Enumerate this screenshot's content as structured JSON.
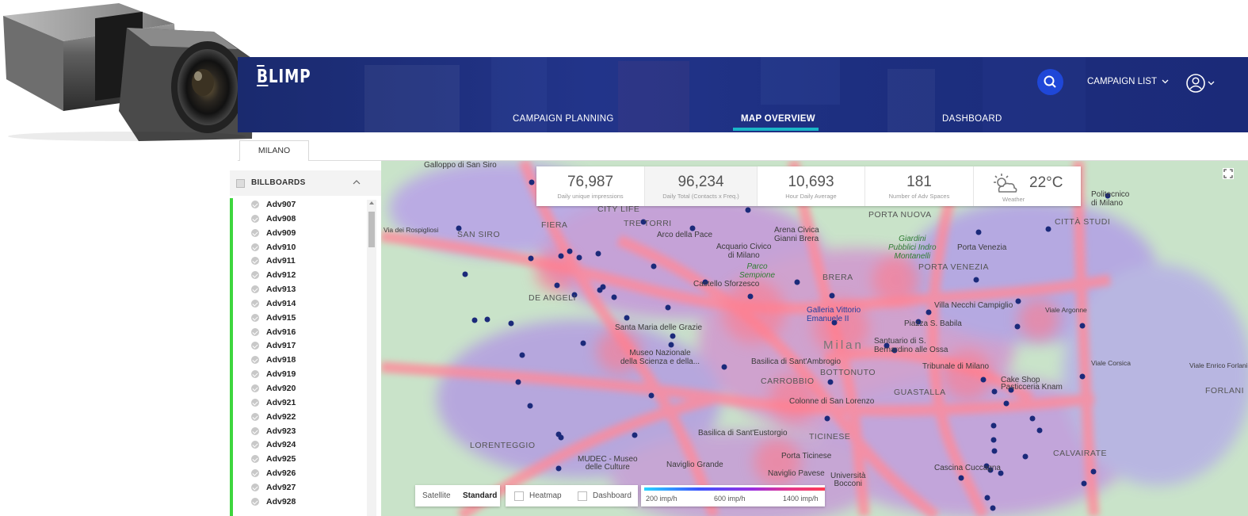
{
  "app": {
    "logo": "BLIMP"
  },
  "nav": {
    "items": [
      "CAMPAIGN PLANNING",
      "MAP OVERVIEW",
      "DASHBOARD"
    ],
    "active": "MAP OVERVIEW",
    "campaign_list": "CAMPAIGN LIST",
    "accent": "#19b5c7"
  },
  "city_tab": "MILANO",
  "sidebar": {
    "header": "BILLBOARDS",
    "items": [
      "Adv907",
      "Adv908",
      "Adv909",
      "Adv910",
      "Adv911",
      "Adv912",
      "Adv913",
      "Adv914",
      "Adv915",
      "Adv916",
      "Adv917",
      "Adv918",
      "Adv919",
      "Adv920",
      "Adv921",
      "Adv922",
      "Adv923",
      "Adv924",
      "Adv925",
      "Adv926",
      "Adv927",
      "Adv928"
    ],
    "active_color": "#3dd63d"
  },
  "stats": [
    {
      "value": "76,987",
      "label": "Daily unique impressions"
    },
    {
      "value": "96,234",
      "label": "Daily Total (Contacts x Freq.)"
    },
    {
      "value": "10,693",
      "label": "Hour Daily Average"
    },
    {
      "value": "181",
      "label": "Number of Adv Spaces"
    }
  ],
  "weather": {
    "temp": "22°C",
    "label": "Weather",
    "icon": "partly-cloudy-icon"
  },
  "map_controls": {
    "satellite": "Satellite",
    "standard": "Standard",
    "heatmap": "Heatmap",
    "dashboard": "Dashboard",
    "legend": [
      "200 imp/h",
      "600 imp/h",
      "1400 imp/h"
    ]
  },
  "map_labels": {
    "galloppo": "Galloppo di San Siro",
    "via_rospigliosi": "Via dei Rospigliosi",
    "san_siro": "SAN SIRO",
    "fiera": "FIERA",
    "city_life": "CITY LIFE",
    "tre_torri": "TRE TORRI",
    "arco": "Arco della Pace",
    "acquario": "Acquario Civico\ndi Milano",
    "parco": "Parco\nSempione",
    "arena": "Arena Civica\nGianni Brera",
    "giardini": "Giardini\nPubblici Indro\nMontanelli",
    "porta_venezia_pin": "Porta Venezia",
    "porta_venezia": "PORTA VENEZIA",
    "porta_nuova": "PORTA NUOVA",
    "citta_studi": "CITTÀ STUDI",
    "politecnico": "Politecnico\ndi Milano",
    "de_angeli": "DE ANGELI",
    "castello": "Castello Sforzesco",
    "brera": "BRERA",
    "villa_necchi": "Villa Necchi Campiglio",
    "galleria": "Galleria Vittorio\nEmanuele II",
    "babila": "Piazza S. Babila",
    "santa_maria": "Santa Maria delle Grazie",
    "museo": "Museo Nazionale\ndella Scienza e della...",
    "milan": "Milan",
    "santuario": "Santuario di S.\nBernardino alle Ossa",
    "viale_argonne": "Viale Argonne",
    "basilica_ambrogio": "Basilica di Sant'Ambrogio",
    "bottonuto": "BOTTONUTO",
    "tribunale": "Tribunale di Milano",
    "viale_corsica": "Viale Corsica",
    "viale_forlanini": "Viale Enrico Forlanini",
    "carrobbio": "CARROBBIO",
    "cake_shop": "Cake Shop\nPasticceria Knam",
    "guastalla": "GUASTALLA",
    "forlanini": "FORLANI",
    "colonne": "Colonne di San Lorenzo",
    "lorenteggio": "LORENTEGGIO",
    "basilica_eustorgio": "Basilica di Sant'Eustorgio",
    "ticinese": "TICINESE",
    "porta_ticinese": "Porta Ticinese",
    "calvairate": "CALVAIRATE",
    "mudec": "MUDEC - Museo\ndelle Culture",
    "naviglio_grande": "Naviglio Grande",
    "naviglio_pavese": "Naviglio Pavese",
    "bocconi": "Università\nBocconi",
    "cascina": "Cascina Cuccagna"
  }
}
